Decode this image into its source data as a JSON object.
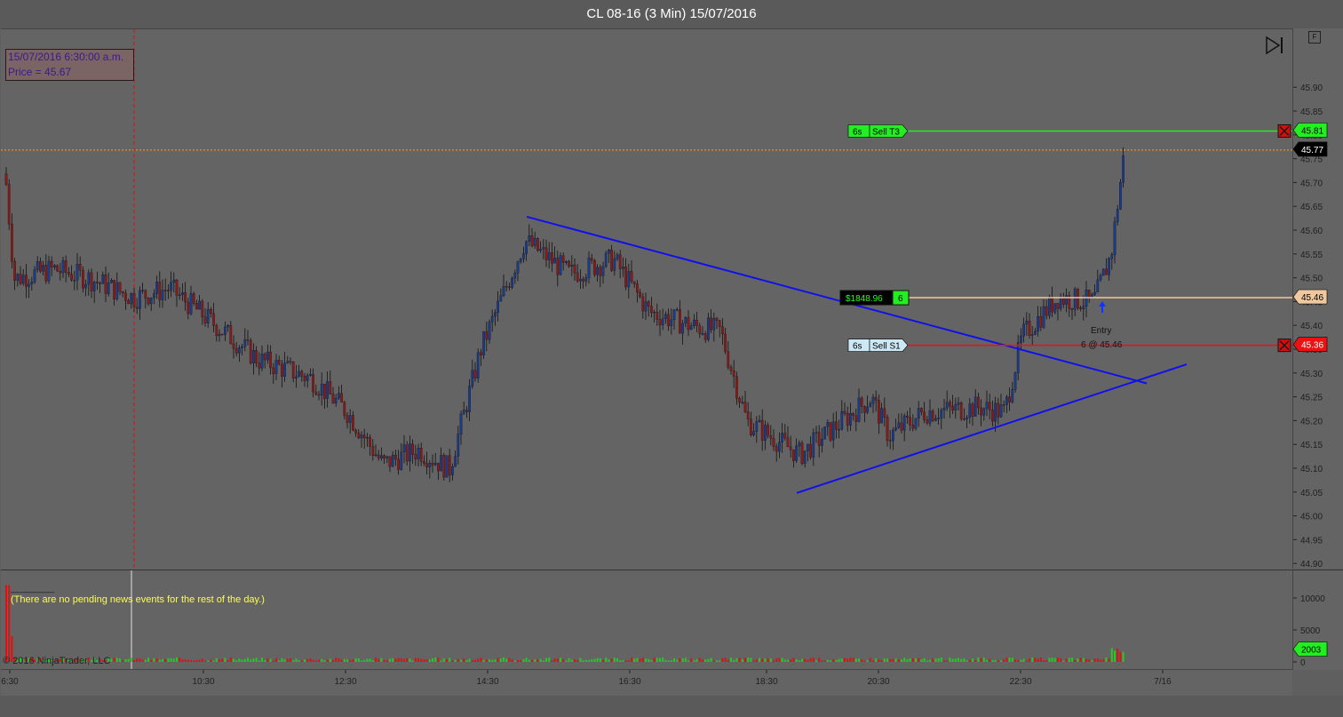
{
  "window": {
    "title": "CL 08-16 (3 Min)  15/07/2016"
  },
  "crosshair": {
    "datetime": "15/07/2016 6:30:00 a.m.",
    "price": "Price = 45.67"
  },
  "price_axis": {
    "ticks": [
      "45.90",
      "45.85",
      "45.80",
      "45.75",
      "45.70",
      "45.65",
      "45.60",
      "45.55",
      "45.50",
      "45.45",
      "45.40",
      "45.35",
      "45.30",
      "45.25",
      "45.20",
      "45.15",
      "45.10",
      "45.05",
      "45.00",
      "44.95",
      "44.90"
    ]
  },
  "volume_axis": {
    "ticks": [
      "10000",
      "5000",
      "0"
    ],
    "current": "2003"
  },
  "time_axis": {
    "ticks": [
      "6:30",
      "10:30",
      "12:30",
      "14:30",
      "16:30",
      "18:30",
      "20:30",
      "22:30",
      "7/16"
    ]
  },
  "orders": {
    "target": {
      "qty": "6s",
      "label": "Sell T3",
      "price": "45.81"
    },
    "stop": {
      "qty": "6s",
      "label": "Sell S1",
      "price": "45.36"
    },
    "position": {
      "pnl": "$1848.96",
      "qty": "6",
      "price": "45.46"
    },
    "last_price": "45.77"
  },
  "entry_marker": {
    "label": "Entry",
    "detail": "6 @ 45.46"
  },
  "news": {
    "dash": "________",
    "text": "(There are no pending news events for the rest of the day.)"
  },
  "copyright": "© 2016 NinjaTrader, LLC",
  "buttons": {
    "f_label": "F"
  },
  "colors": {
    "target": "#22ee22",
    "stop": "#ee1111",
    "position": "#f0c8a0",
    "trendline": "#1010ee",
    "last_price_line": "#ff8c00",
    "up_candle": "#1a3a8a",
    "down_candle": "#8a1a1a"
  }
}
